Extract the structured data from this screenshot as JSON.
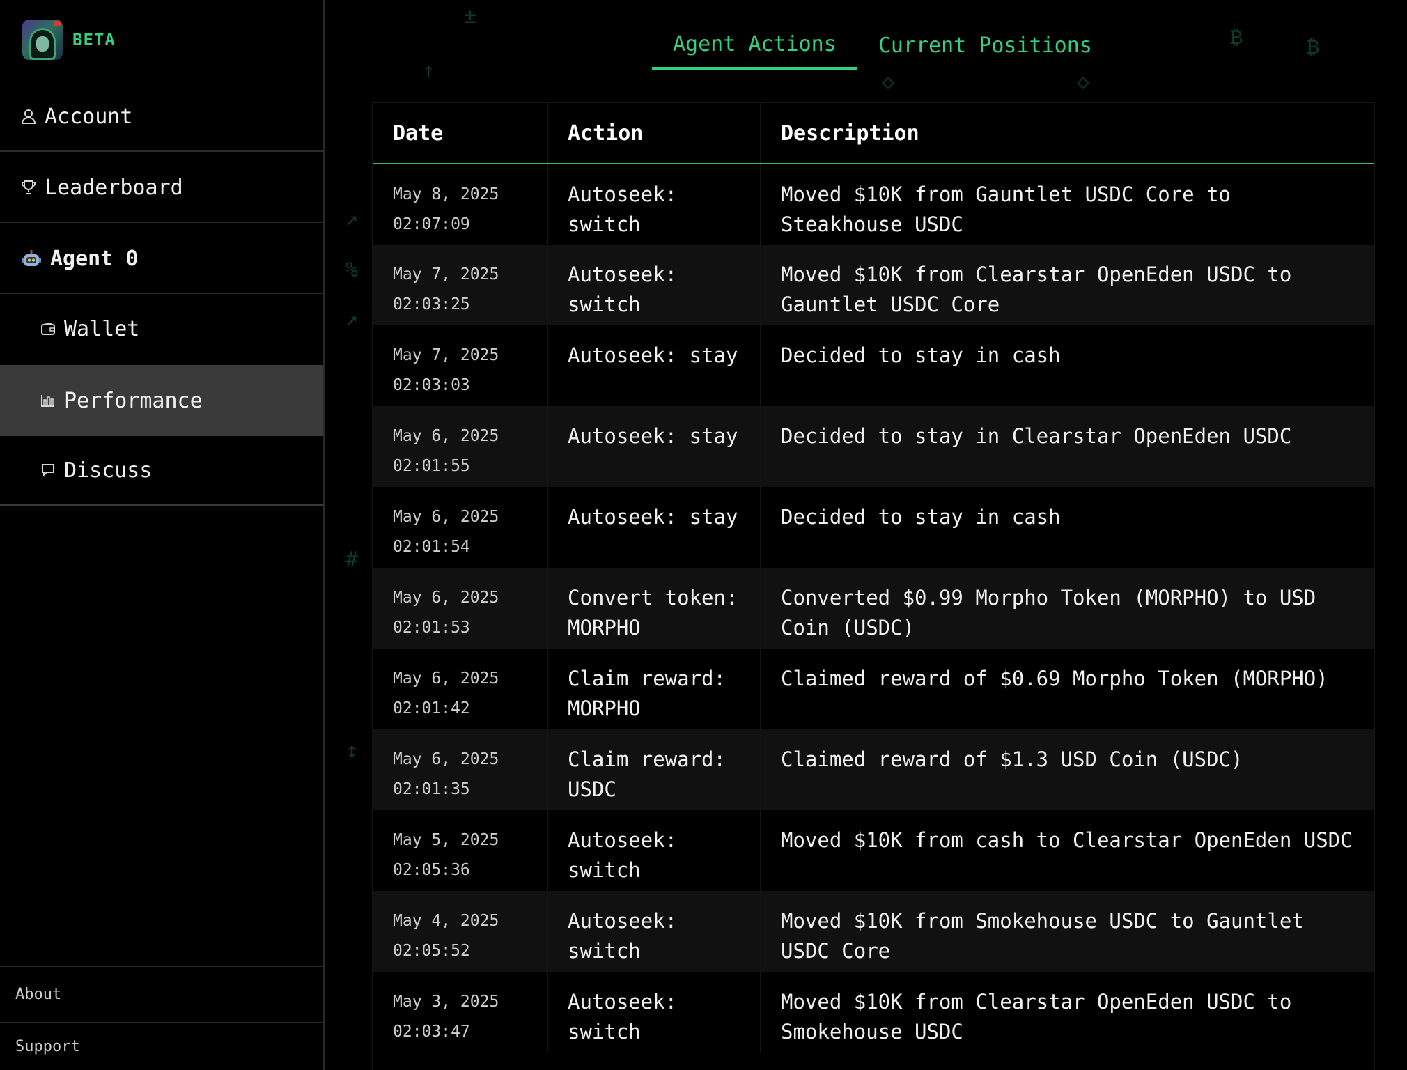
{
  "brand": {
    "badge": "BETA"
  },
  "sidebar": {
    "items": [
      {
        "label": "Account",
        "icon": "user-icon"
      },
      {
        "label": "Leaderboard",
        "icon": "trophy-icon"
      },
      {
        "label": "Agent 0",
        "icon": "robot-icon"
      },
      {
        "label": "Wallet",
        "icon": "wallet-icon"
      },
      {
        "label": "Performance",
        "icon": "bar-chart-icon",
        "active": true
      },
      {
        "label": "Discuss",
        "icon": "chat-bubble-icon"
      }
    ],
    "footer": {
      "about": "About",
      "support": "Support"
    }
  },
  "tabs": [
    {
      "label": "Agent Actions",
      "active": true
    },
    {
      "label": "Current Positions",
      "active": false
    }
  ],
  "table": {
    "headers": [
      "Date",
      "Action",
      "Description"
    ],
    "rows": [
      {
        "date": "May 8, 2025",
        "time": "02:07:09",
        "action": "Autoseek: switch",
        "description": "Moved $10K from Gauntlet USDC Core to Steakhouse USDC"
      },
      {
        "date": "May 7, 2025",
        "time": "02:03:25",
        "action": "Autoseek: switch",
        "description": "Moved $10K from Clearstar OpenEden USDC to Gauntlet USDC Core"
      },
      {
        "date": "May 7, 2025",
        "time": "02:03:03",
        "action": "Autoseek: stay",
        "description": "Decided to stay in cash"
      },
      {
        "date": "May 6, 2025",
        "time": "02:01:55",
        "action": "Autoseek: stay",
        "description": "Decided to stay in Clearstar OpenEden USDC"
      },
      {
        "date": "May 6, 2025",
        "time": "02:01:54",
        "action": "Autoseek: stay",
        "description": "Decided to stay in cash"
      },
      {
        "date": "May 6, 2025",
        "time": "02:01:53",
        "action": "Convert token: MORPHO",
        "description": "Converted $0.99 Morpho Token (MORPHO) to USD Coin (USDC)"
      },
      {
        "date": "May 6, 2025",
        "time": "02:01:42",
        "action": "Claim reward: MORPHO",
        "description": "Claimed reward of $0.69 Morpho Token (MORPHO)"
      },
      {
        "date": "May 6, 2025",
        "time": "02:01:35",
        "action": "Claim reward: USDC",
        "description": "Claimed reward of $1.3 USD Coin (USDC)"
      },
      {
        "date": "May 5, 2025",
        "time": "02:05:36",
        "action": "Autoseek: switch",
        "description": "Moved $10K from cash to Clearstar OpenEden USDC"
      },
      {
        "date": "May 4, 2025",
        "time": "02:05:52",
        "action": "Autoseek: switch",
        "description": "Moved $10K from Smokehouse USDC to Gauntlet USDC Core"
      },
      {
        "date": "May 3, 2025",
        "time": "02:03:47",
        "action": "Autoseek: switch",
        "description": "Moved $10K from Clearstar OpenEden USDC to Smokehouse USDC"
      }
    ]
  },
  "colors": {
    "accent": "#35d07f",
    "active_row": "#3a3a3a",
    "stripe": "#111111"
  }
}
